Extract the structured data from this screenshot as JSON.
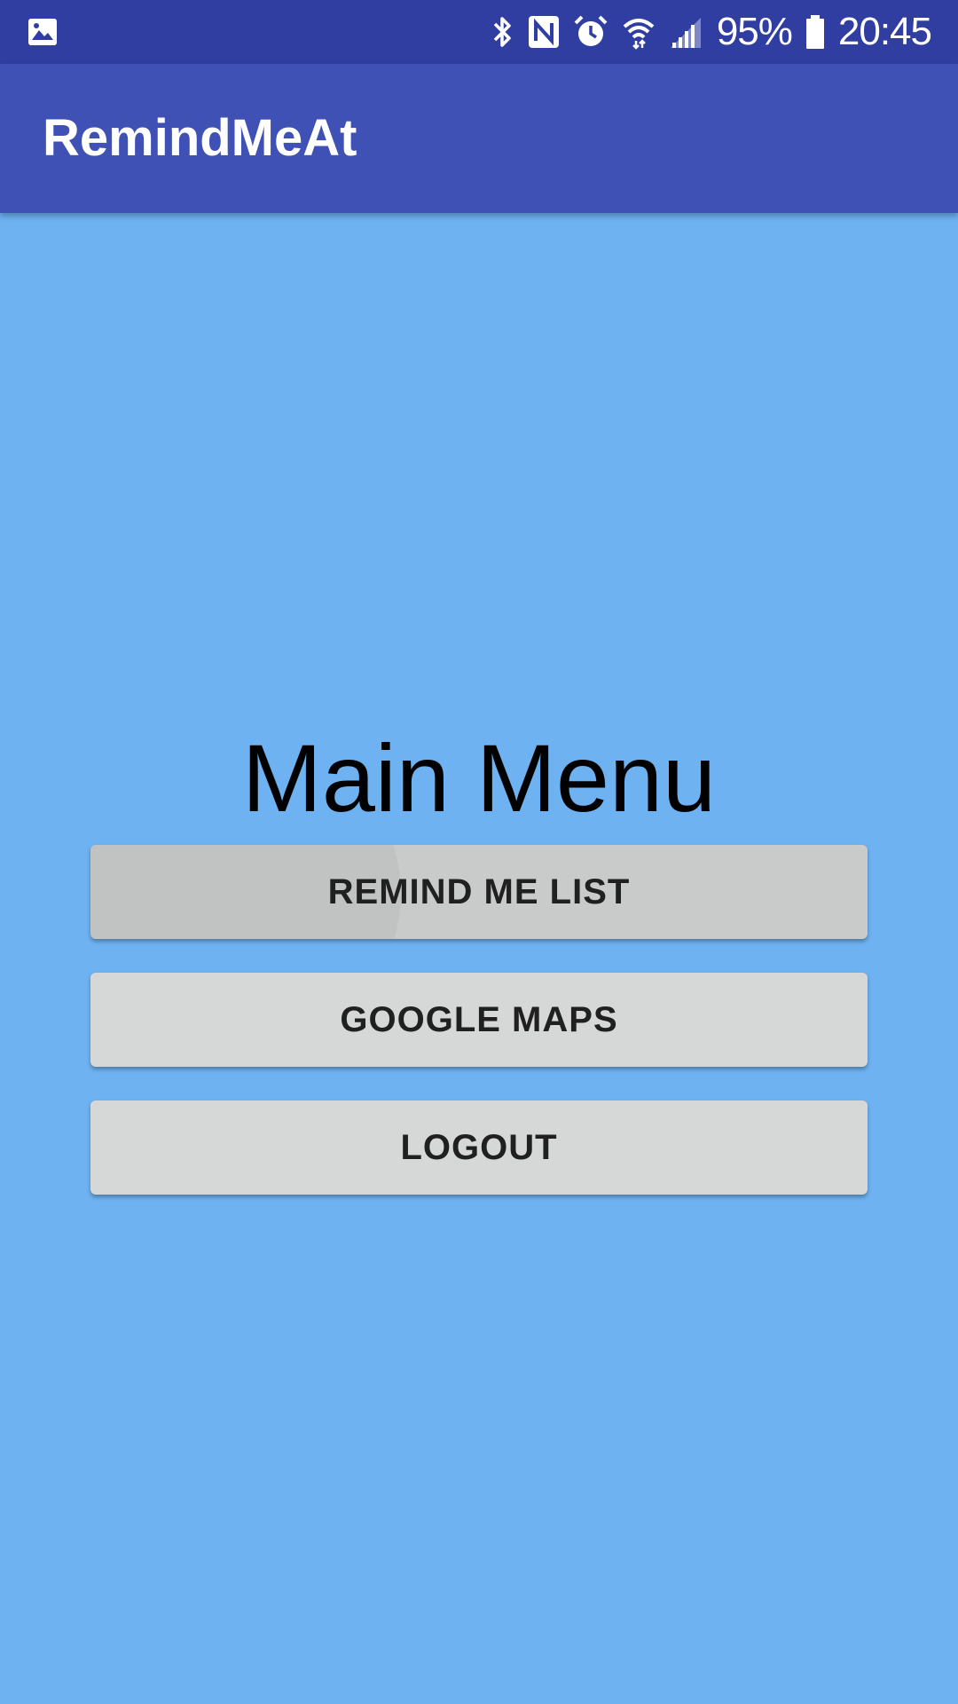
{
  "status_bar": {
    "battery_percent": "95%",
    "time": "20:45",
    "icons": [
      "gallery-icon",
      "bluetooth-icon",
      "nfc-icon",
      "alarm-icon",
      "wifi-icon",
      "signal-icon",
      "battery-icon"
    ]
  },
  "app_bar": {
    "title": "RemindMeAt"
  },
  "main": {
    "title": "Main Menu",
    "buttons": [
      {
        "label": "REMIND ME LIST"
      },
      {
        "label": "GOOGLE MAPS"
      },
      {
        "label": "LOGOUT"
      }
    ]
  },
  "colors": {
    "status_bar": "#2f3ea0",
    "app_bar": "#3f51b5",
    "background": "#6eb2f2",
    "button": "#d6d7d7"
  }
}
